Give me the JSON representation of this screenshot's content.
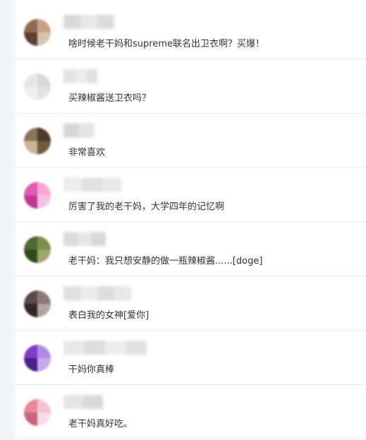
{
  "comments": [
    {
      "text": "啥时候老干妈和supreme联名出卫衣啊？买爆！",
      "avatar_colors": [
        "#8f6b57",
        "#c9a084",
        "#5e3f33",
        "#d7c3ad"
      ]
    },
    {
      "text": "买辣椒酱送卫衣吗？",
      "avatar_colors": [
        "#e6e6e6",
        "#d9d9d9",
        "#efefef",
        "#e2e2e2"
      ]
    },
    {
      "text": "非常喜欢",
      "avatar_colors": [
        "#8a7454",
        "#4e3a2c",
        "#c7b89c",
        "#6f5b40"
      ]
    },
    {
      "text": "厉害了我的老干妈，大学四年的记忆啊",
      "avatar_colors": [
        "#e25bb0",
        "#f7a6d8",
        "#c23a8f",
        "#f4c1e3"
      ]
    },
    {
      "text": "老干妈：我只想安静的做一瓶辣椒酱......[doge]",
      "avatar_colors": [
        "#4c6b2e",
        "#7d8f4a",
        "#2e4a1f",
        "#a3a76a"
      ]
    },
    {
      "text": "表白我的女神[爱你]",
      "avatar_colors": [
        "#5a4a4a",
        "#8c7a7a",
        "#2f2525",
        "#b3a3a3"
      ]
    },
    {
      "text": "干妈你真棒",
      "avatar_colors": [
        "#7b3fc4",
        "#b18ae6",
        "#4a1f8a",
        "#caa8f0"
      ]
    },
    {
      "text": "老干妈真好吃。",
      "avatar_colors": [
        "#e88a9e",
        "#f5c3cf",
        "#c7657c",
        "#f9dce3"
      ]
    }
  ]
}
